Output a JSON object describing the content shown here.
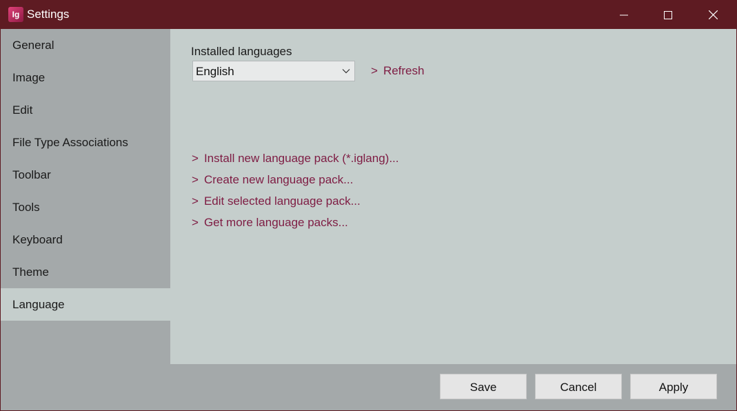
{
  "window": {
    "title": "Settings",
    "app_icon_text": "Ig",
    "controls": {
      "minimize": "minimize-icon",
      "maximize": "maximize-icon",
      "close": "close-icon"
    }
  },
  "sidebar": {
    "items": [
      {
        "label": "General"
      },
      {
        "label": "Image"
      },
      {
        "label": "Edit"
      },
      {
        "label": "File Type Associations"
      },
      {
        "label": "Toolbar"
      },
      {
        "label": "Tools"
      },
      {
        "label": "Keyboard"
      },
      {
        "label": "Theme"
      },
      {
        "label": "Language"
      }
    ],
    "selected": "Language"
  },
  "language": {
    "installed_label": "Installed languages",
    "selected_language": "English",
    "refresh": "Refresh",
    "links": [
      "Install new language pack (*.iglang)...",
      "Create new language pack...",
      "Edit selected language pack...",
      "Get more language packs..."
    ],
    "link_prefix": ">"
  },
  "footer": {
    "save": "Save",
    "cancel": "Cancel",
    "apply": "Apply"
  },
  "colors": {
    "titlebar": "#5e1b22",
    "sidebar": "#a4a9aa",
    "content": "#c5cecc",
    "link": "#7e1c43"
  }
}
